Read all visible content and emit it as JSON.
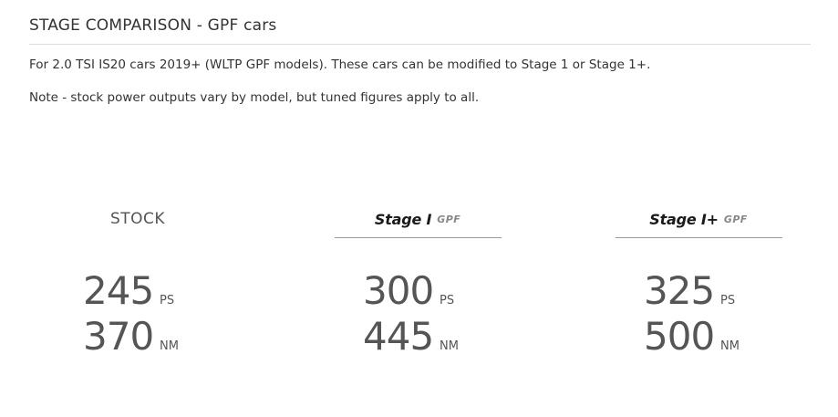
{
  "header": {
    "title": "STAGE COMPARISON - GPF cars"
  },
  "intro": {
    "paragraph_1": "For 2.0 TSI IS20 cars 2019+ (WLTP GPF models). These cars can be modified to Stage 1 or Stage 1+.",
    "paragraph_2": "Note - stock power outputs vary by model, but tuned figures apply to all."
  },
  "columns": [
    {
      "label": "STOCK",
      "power_value": "245",
      "power_unit": "PS",
      "torque_value": "370",
      "torque_unit": "NM"
    },
    {
      "label": "Stage I",
      "label_suffix": "GPF",
      "power_value": "300",
      "power_unit": "PS",
      "torque_value": "445",
      "torque_unit": "NM"
    },
    {
      "label": "Stage I+",
      "label_suffix": "GPF",
      "power_value": "325",
      "power_unit": "PS",
      "torque_value": "500",
      "torque_unit": "NM"
    }
  ],
  "colors": {
    "text": "#333333",
    "figures": "#555555",
    "stage_logo": "#1a1a1a",
    "stage_suffix": "#888888",
    "rule": "#999999"
  }
}
